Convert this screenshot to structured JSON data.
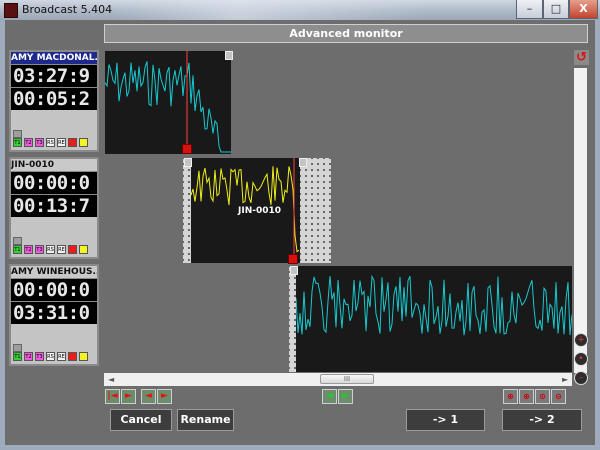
{
  "window": {
    "title": "Broadcast 5.404",
    "min_label": "–",
    "max_label": "□",
    "close_label": "X"
  },
  "panel": {
    "title": "Advanced monitor"
  },
  "channels": [
    {
      "name": "AMY MACDONAL...",
      "time1": "03:27:9",
      "time2": "00:05:2",
      "selected": true
    },
    {
      "name": "JIN-0010",
      "time1": "00:00:0",
      "time2": "00:13:7",
      "selected": false
    },
    {
      "name": "AMY WINEHOUS...",
      "time1": "00:00:0",
      "time2": "03:31:0",
      "selected": false
    }
  ],
  "tags": [
    "T1",
    "T2",
    "T3",
    "RS",
    "RE",
    "",
    ""
  ],
  "tracks": [
    {
      "label": "",
      "color": "#17c9cf"
    },
    {
      "label": "JIN-0010",
      "color": "#f0ef1a"
    },
    {
      "label": "",
      "color": "#17c9cf"
    }
  ],
  "hscroll_thumb_label": "III",
  "buttons": {
    "cancel": "Cancel",
    "rename": "Rename",
    "out1": "-> 1",
    "out2": "-> 2"
  }
}
